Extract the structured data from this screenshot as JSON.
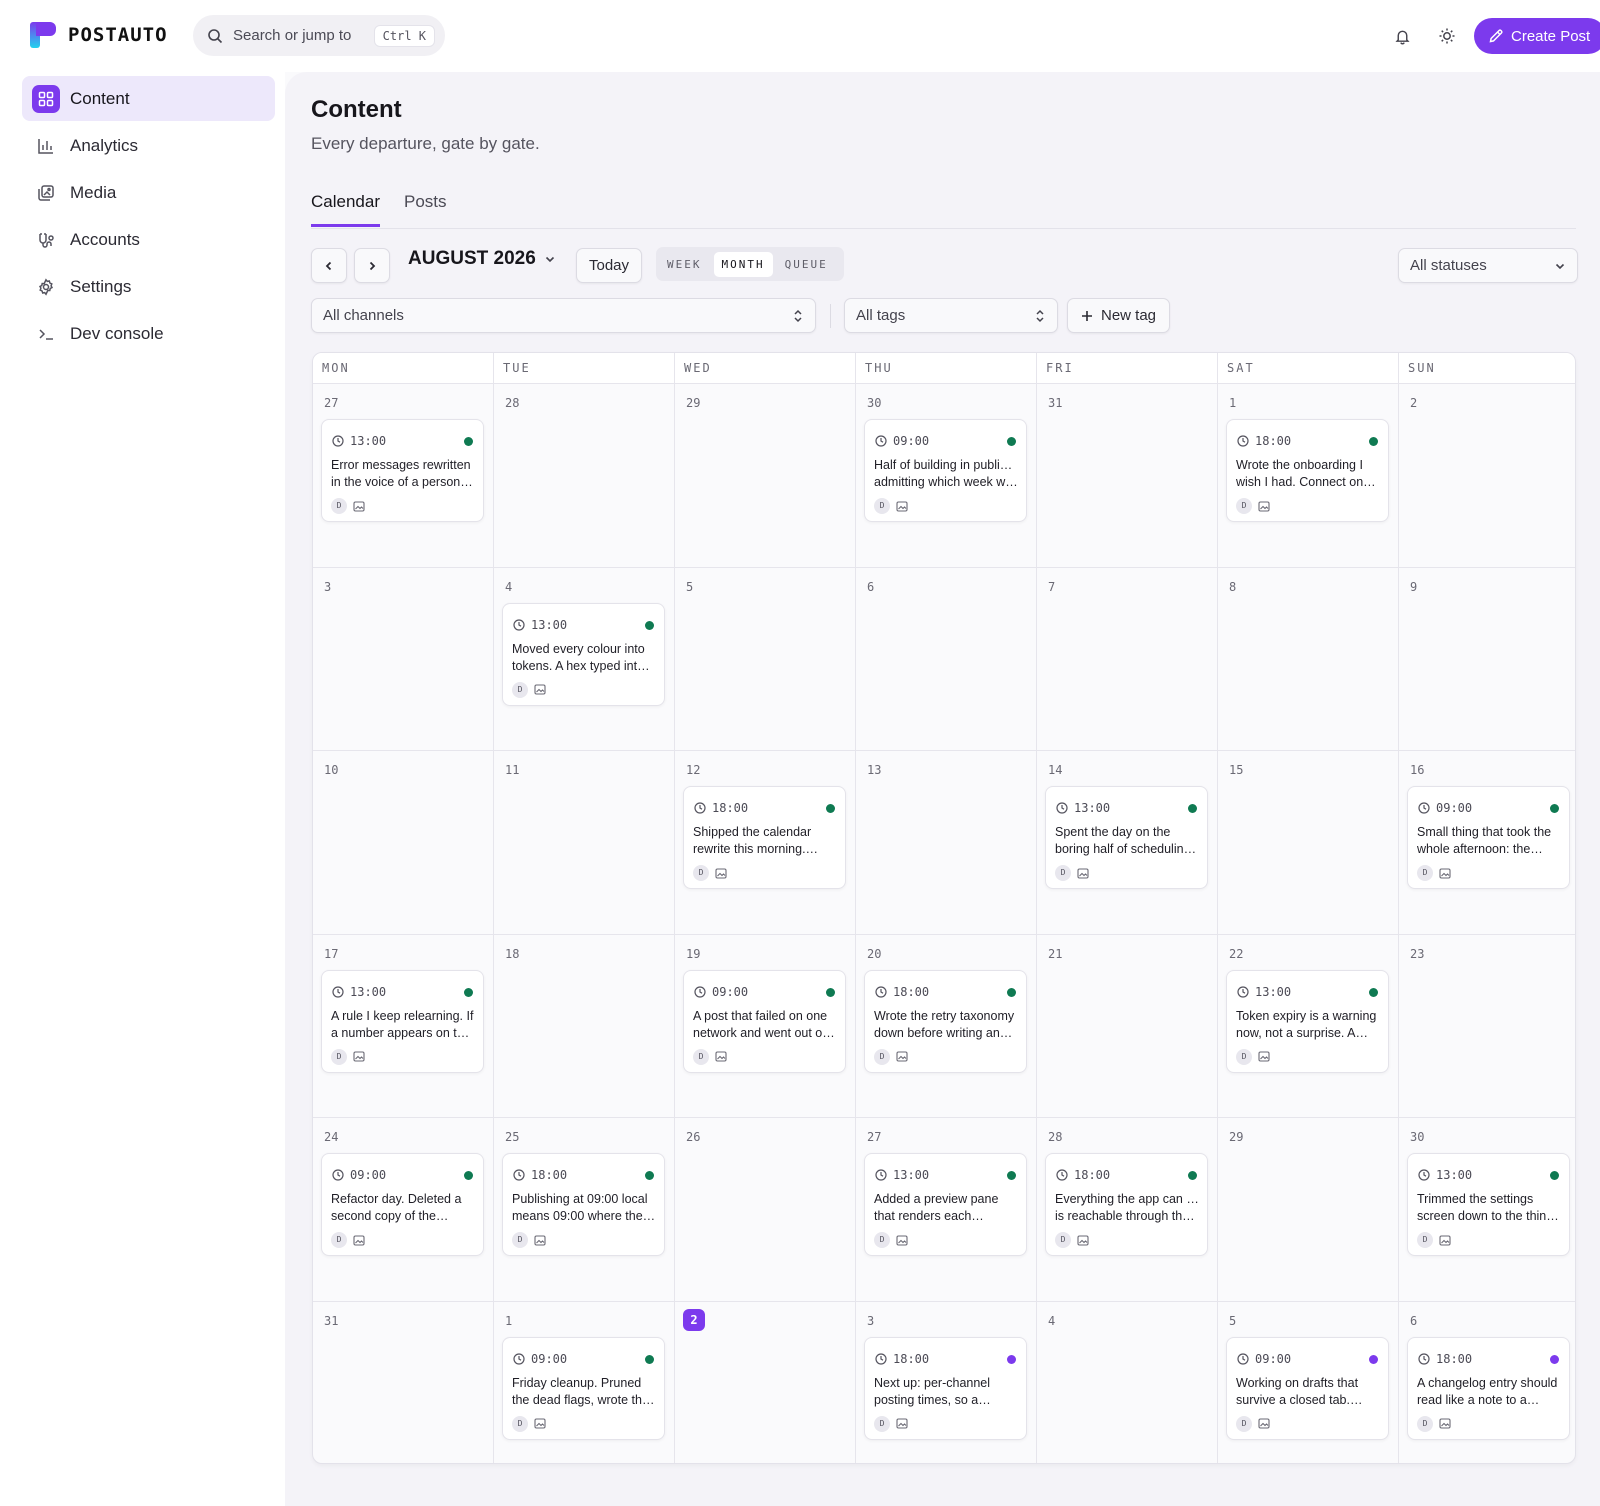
{
  "app": {
    "name": "POSTAUTO"
  },
  "search": {
    "placeholder": "Search or jump to",
    "shortcut": "Ctrl K"
  },
  "header": {
    "create_label": "Create Post"
  },
  "sidebar": {
    "items": [
      {
        "label": "Content",
        "icon": "grid-icon",
        "active": true
      },
      {
        "label": "Analytics",
        "icon": "bar-chart-icon",
        "active": false
      },
      {
        "label": "Media",
        "icon": "images-icon",
        "active": false
      },
      {
        "label": "Accounts",
        "icon": "accounts-icon",
        "active": false
      },
      {
        "label": "Settings",
        "icon": "gear-icon",
        "active": false
      },
      {
        "label": "Dev console",
        "icon": "terminal-icon",
        "active": false
      }
    ]
  },
  "page": {
    "title": "Content",
    "subtitle": "Every departure, gate by gate."
  },
  "tabs": [
    {
      "label": "Calendar",
      "active": true
    },
    {
      "label": "Posts",
      "active": false
    }
  ],
  "toolbar": {
    "month_label": "AUGUST 2026",
    "today_label": "Today",
    "views": [
      "WEEK",
      "MONTH",
      "QUEUE"
    ],
    "active_view": "MONTH",
    "status_filter": "All statuses",
    "channels_filter": "All channels",
    "tags_filter": "All tags",
    "new_tag_label": "New tag"
  },
  "colors": {
    "accent": "#7c3aed",
    "published": "#0f7a52",
    "scheduled": "#7c3aed"
  },
  "calendar": {
    "weekdays": [
      "MON",
      "TUE",
      "WED",
      "THU",
      "FRI",
      "SAT",
      "SUN"
    ],
    "today": "2",
    "avatar_initial": "D",
    "weeks": [
      [
        {
          "day": "27",
          "post": {
            "time": "13:00",
            "status": "published",
            "text": [
              "Error messages rewritten",
              "in the voice of a person…"
            ]
          }
        },
        {
          "day": "28"
        },
        {
          "day": "29"
        },
        {
          "day": "30",
          "post": {
            "time": "09:00",
            "status": "published",
            "text": [
              "Half of building in public is",
              "admitting which week w…"
            ]
          }
        },
        {
          "day": "31"
        },
        {
          "day": "1",
          "post": {
            "time": "18:00",
            "status": "published",
            "text": [
              "Wrote the onboarding I",
              "wish I had. Connect one…"
            ]
          }
        },
        {
          "day": "2"
        }
      ],
      [
        {
          "day": "3"
        },
        {
          "day": "4",
          "post": {
            "time": "13:00",
            "status": "published",
            "text": [
              "Moved every colour into",
              "tokens. A hex typed into …"
            ]
          }
        },
        {
          "day": "5"
        },
        {
          "day": "6"
        },
        {
          "day": "7"
        },
        {
          "day": "8"
        },
        {
          "day": "9"
        }
      ],
      [
        {
          "day": "10"
        },
        {
          "day": "11"
        },
        {
          "day": "12",
          "post": {
            "time": "18:00",
            "status": "published",
            "text": [
              "Shipped the calendar",
              "rewrite this morning.…"
            ]
          }
        },
        {
          "day": "13"
        },
        {
          "day": "14",
          "post": {
            "time": "13:00",
            "status": "published",
            "text": [
              "Spent the day on the",
              "boring half of scheduling…"
            ]
          }
        },
        {
          "day": "15"
        },
        {
          "day": "16",
          "post": {
            "time": "09:00",
            "status": "published",
            "text": [
              "Small thing that took the",
              "whole afternoon: the…"
            ]
          }
        }
      ],
      [
        {
          "day": "17",
          "post": {
            "time": "13:00",
            "status": "published",
            "text": [
              "A rule I keep relearning. If",
              "a number appears on tw…"
            ]
          }
        },
        {
          "day": "18"
        },
        {
          "day": "19",
          "post": {
            "time": "09:00",
            "status": "published",
            "text": [
              "A post that failed on one",
              "network and went out o…"
            ]
          }
        },
        {
          "day": "20",
          "post": {
            "time": "18:00",
            "status": "published",
            "text": [
              "Wrote the retry taxonomy",
              "down before writing any…"
            ]
          }
        },
        {
          "day": "21"
        },
        {
          "day": "22",
          "post": {
            "time": "13:00",
            "status": "published",
            "text": [
              "Token expiry is a warning",
              "now, not a surprise. A…"
            ]
          }
        },
        {
          "day": "23"
        }
      ],
      [
        {
          "day": "24",
          "post": {
            "time": "09:00",
            "status": "published",
            "text": [
              "Refactor day. Deleted a",
              "second copy of the…"
            ]
          }
        },
        {
          "day": "25",
          "post": {
            "time": "18:00",
            "status": "published",
            "text": [
              "Publishing at 09:00 local",
              "means 09:00 where the…"
            ]
          }
        },
        {
          "day": "26"
        },
        {
          "day": "27",
          "post": {
            "time": "13:00",
            "status": "published",
            "text": [
              "Added a preview pane",
              "that renders each…"
            ]
          }
        },
        {
          "day": "28",
          "post": {
            "time": "18:00",
            "status": "published",
            "text": [
              "Everything the app can do",
              "is reachable through the…"
            ]
          }
        },
        {
          "day": "29"
        },
        {
          "day": "30",
          "post": {
            "time": "13:00",
            "status": "published",
            "text": [
              "Trimmed the settings",
              "screen down to the thing…"
            ]
          }
        }
      ],
      [
        {
          "day": "31"
        },
        {
          "day": "1",
          "post": {
            "time": "09:00",
            "status": "published",
            "text": [
              "Friday cleanup. Pruned",
              "the dead flags, wrote the…"
            ]
          }
        },
        {
          "day": "2",
          "today": true
        },
        {
          "day": "3",
          "post": {
            "time": "18:00",
            "status": "scheduled",
            "text": [
              "Next up: per-channel",
              "posting times, so a…"
            ]
          }
        },
        {
          "day": "4"
        },
        {
          "day": "5",
          "post": {
            "time": "09:00",
            "status": "scheduled",
            "text": [
              "Working on drafts that",
              "survive a closed tab.…"
            ]
          }
        },
        {
          "day": "6",
          "post": {
            "time": "18:00",
            "status": "scheduled",
            "text": [
              "A changelog entry should",
              "read like a note to a…"
            ]
          }
        }
      ]
    ]
  }
}
